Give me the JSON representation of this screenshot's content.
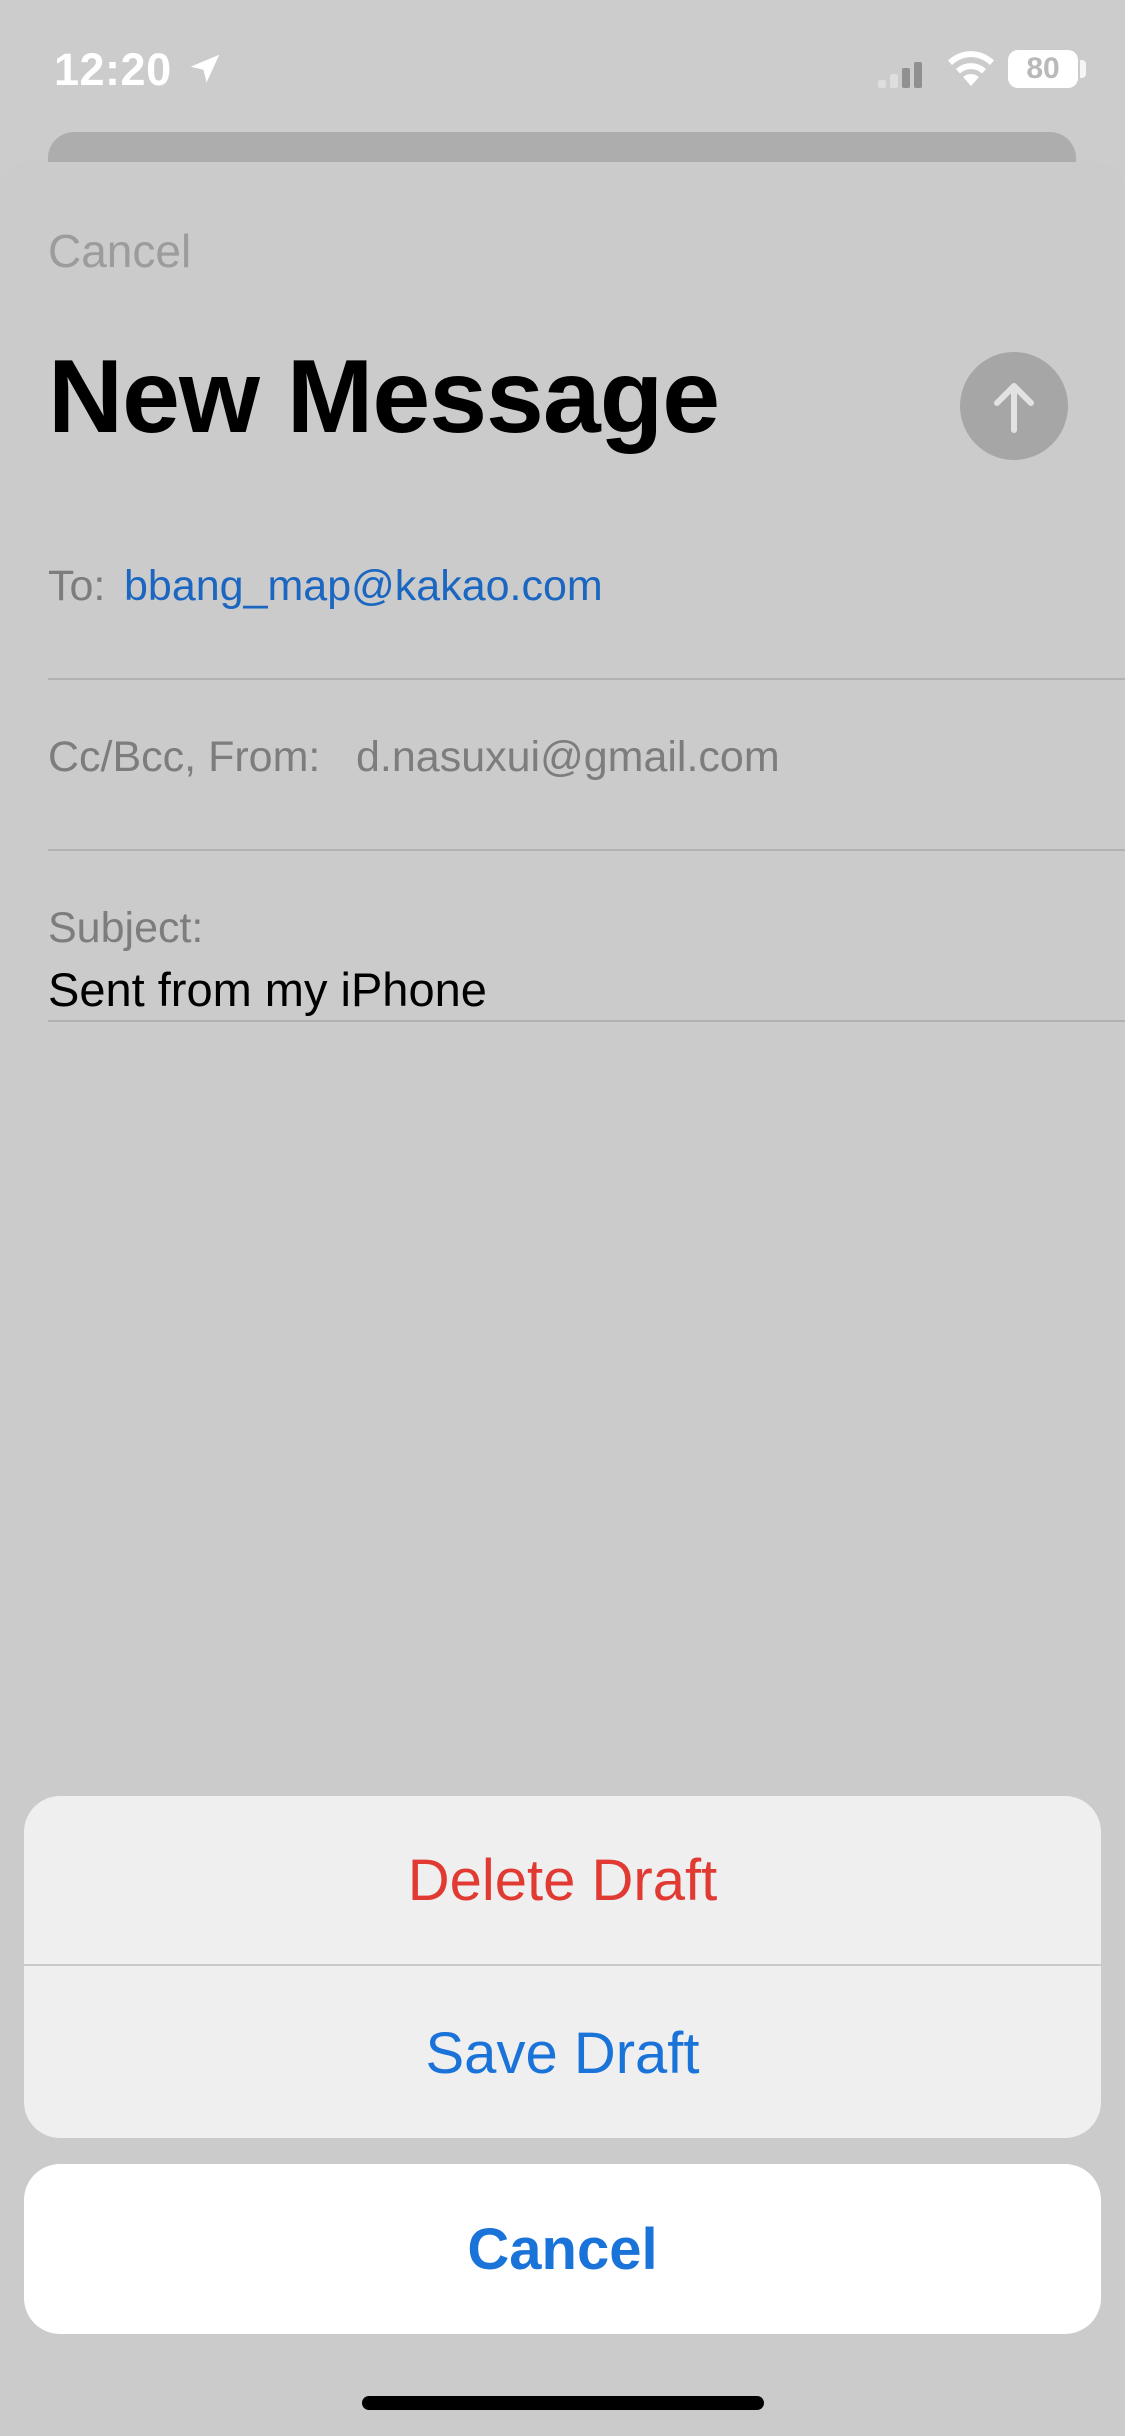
{
  "status_bar": {
    "time": "12:20",
    "battery": "80",
    "icons": [
      "location-arrow-icon",
      "cellular-signal-icon",
      "wifi-icon",
      "battery-icon"
    ]
  },
  "compose": {
    "cancel_label": "Cancel",
    "title": "New Message",
    "send_icon": "arrow-up-icon",
    "to_label": "To:",
    "to_value": "bbang_map@kakao.com",
    "cc_label": "Cc/Bcc, From:",
    "from_value": "d.nasuxui@gmail.com",
    "subject_label": "Subject:",
    "body": "Sent from my iPhone"
  },
  "action_sheet": {
    "delete_label": "Delete Draft",
    "save_label": "Save Draft",
    "cancel_label": "Cancel"
  },
  "colors": {
    "dim_background": "#cccccc",
    "link_blue": "#1b66c0",
    "action_blue": "#1a73d9",
    "destructive_red": "#e13a32"
  }
}
